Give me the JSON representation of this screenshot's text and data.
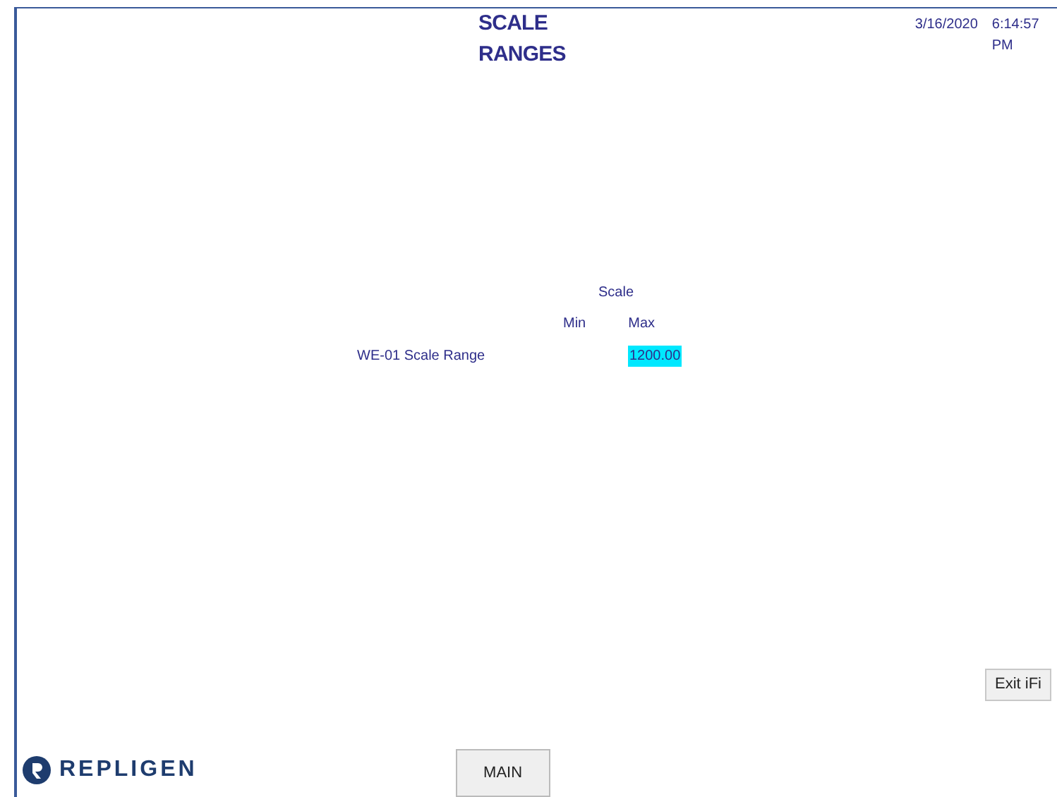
{
  "header": {
    "title": "SCALE RANGES",
    "date": "3/16/2020",
    "time": "6:14:57 PM"
  },
  "table": {
    "group_heading": "Scale",
    "columns": [
      "Min",
      "Max"
    ],
    "rows": [
      {
        "label": "WE-01 Scale Range",
        "max": "1200.00"
      }
    ]
  },
  "exit_button": "Exit iFi",
  "logo": "REPLIGEN",
  "main_button": "MAIN"
}
